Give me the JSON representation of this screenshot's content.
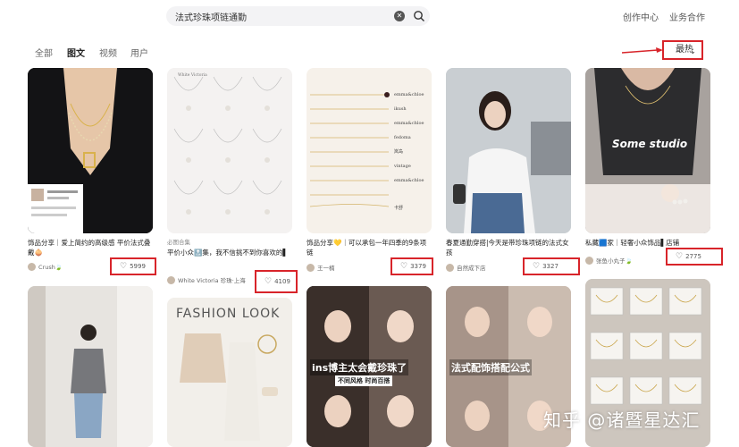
{
  "search": {
    "query": "法式珍珠项链通勤"
  },
  "header": {
    "creator_center": "创作中心",
    "business": "业务合作"
  },
  "tabs": [
    "全部",
    "图文",
    "视频",
    "用户"
  ],
  "sort": {
    "label": "最热"
  },
  "cards": [
    {
      "title": "饰品分享｜爱上简约的高级感 平价法式叠戴🧅",
      "author": "Crush🍃",
      "likes": "5999"
    },
    {
      "badge": "必图合集",
      "title": "平价小众🔝集，我不信挑不到你喜欢的▌",
      "author": "White Victoria 珍珠·上海",
      "likes": "4109"
    },
    {
      "title": "饰品分享💛｜可以承包一年四季的9条项链",
      "author": "王一楠",
      "likes": "3379"
    },
    {
      "title": "春夏通勤穿搭|今天是带珍珠项链的法式女孩",
      "author": "自然成下店",
      "likes": "3327"
    },
    {
      "title": "私藏🟦家｜轻奢小众饰品▌店铺",
      "author": "张鱼小丸子🍃",
      "likes": "2775"
    }
  ],
  "card_images": {
    "white_victoria_label": "White Victoria",
    "necklace_labels": [
      "emma&chloe",
      "ikush",
      "emma&chloe",
      "fedoma",
      "岚岛",
      "vintage",
      "emma&chloe",
      "卡舒"
    ],
    "some_studio": "Some studio",
    "fashion_look": "FASHION LOOK",
    "ins_pearl": "ins博主太会戴珍珠了",
    "ins_sub": "不同风格 时尚百搭",
    "french_formula": "法式配饰搭配公式"
  },
  "watermark": "知乎 @诸暨星达汇"
}
